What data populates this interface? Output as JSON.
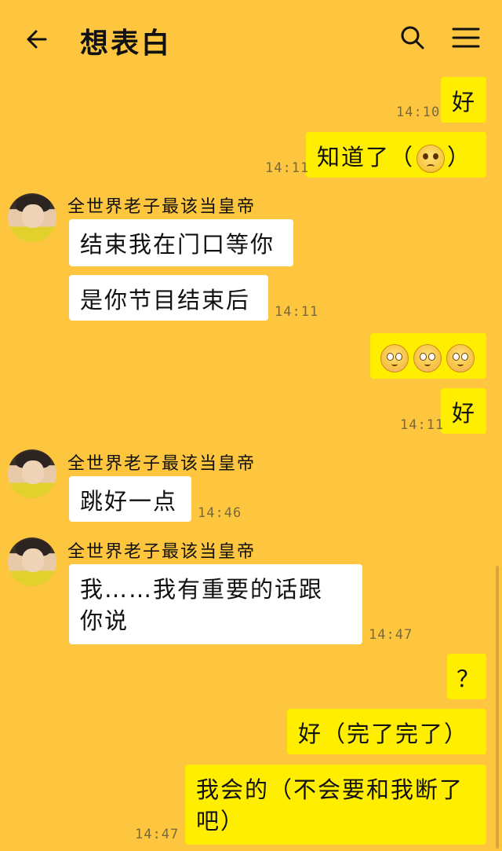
{
  "header": {
    "title": "想表白"
  },
  "messages": {
    "m1": {
      "text": "好",
      "time": "14:10"
    },
    "m2": {
      "text": "知道了（",
      "text_end": "）",
      "time": "14:11"
    },
    "m3": {
      "sender": "全世界老子最该当皇帝",
      "text": "结束我在门口等你"
    },
    "m4": {
      "text": "是你节目结束后",
      "time": "14:11"
    },
    "m5": {
      "emoji": "flushed-face ×3"
    },
    "m6": {
      "text": "好",
      "time": "14:11"
    },
    "m7": {
      "sender": "全世界老子最该当皇帝",
      "text": "跳好一点",
      "time": "14:46"
    },
    "m8": {
      "sender": "全世界老子最该当皇帝",
      "line1": "我……我有重要的话跟",
      "line2": "你说",
      "time": "14:47"
    },
    "m9": {
      "text": "？"
    },
    "m10": {
      "text": "好（完了完了）"
    },
    "m11": {
      "line1": "我会的（不会要和我断了",
      "line2": "吧）",
      "time": "14:47"
    }
  },
  "colors": {
    "background": "#FEC63F",
    "outgoing_bubble": "#FFEE00",
    "incoming_bubble": "#FFFFFF"
  }
}
